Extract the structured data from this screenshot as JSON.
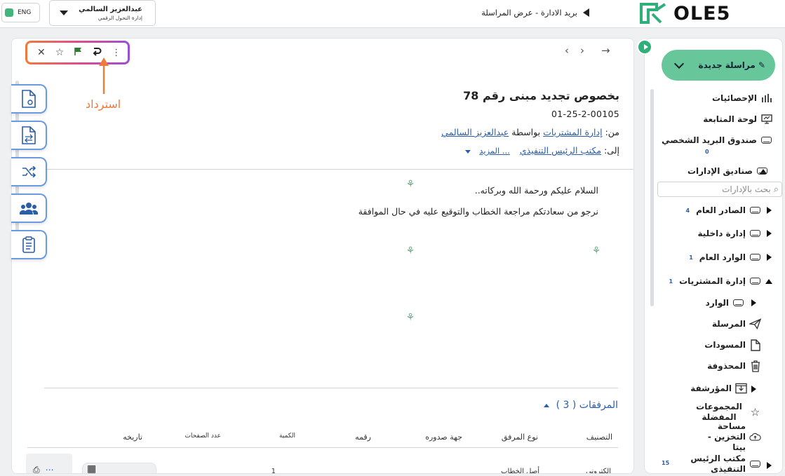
{
  "topbar": {
    "lang_label": "ENG",
    "user_name": "عبدالعزيز السالمي",
    "user_dept": "إدارة التحول الرقمي",
    "breadcrumb": "بريد الادارة - عرض المراسلة",
    "logo_text": "OLE5"
  },
  "sidebar": {
    "new_message": "مراسلة جديدة",
    "dept_search_placeholder": "بحث بالإدارات",
    "items": [
      {
        "label": "الإحصائيات",
        "icon": "bar-chart-icon"
      },
      {
        "label": "لوحة المتابعة",
        "icon": "dashboard-icon"
      },
      {
        "label": "صندوق البريد الشخصي",
        "icon": "inbox-icon",
        "count": "0"
      },
      {
        "label": "صناديق الإدارات",
        "icon": "inbox-icon"
      },
      {
        "label": "الصادر العام",
        "icon": "inbox-icon",
        "count": "4"
      },
      {
        "label": "إدارة داخلية",
        "icon": "inbox-icon"
      },
      {
        "label": "الوارد العام",
        "icon": "inbox-icon",
        "count": "1"
      },
      {
        "label": "إدارة المشتريات",
        "icon": "inbox-icon",
        "count": "1"
      },
      {
        "label": "الوارد",
        "icon": "inbox-icon"
      },
      {
        "label": "المرسلة",
        "icon": "send-icon"
      },
      {
        "label": "المسودات",
        "icon": "draft-icon"
      },
      {
        "label": "المحذوفة",
        "icon": "trash-icon"
      },
      {
        "label": "المؤرشفة",
        "icon": "archive-icon"
      },
      {
        "label": "المجموعات المفضلة",
        "icon": "star-icon"
      },
      {
        "label": "مساحة التخزين - بيتا",
        "icon": "cloud-icon"
      },
      {
        "label": "مكتب الرئيس التنفيذي",
        "icon": "inbox-icon",
        "count": "15"
      }
    ]
  },
  "message": {
    "subject": "بخصوص تجديد مبنى رقم 78",
    "ref_no": "01-25-2-00105",
    "from_label": "من:",
    "from_dept": "إدارة المشتريات",
    "by_label": "بواسطة",
    "from_user": "عبدالعزيز السالمي",
    "to_label": "إلى:",
    "to_dept": "مكتب الرئيس التنفيذي",
    "more_label": "... المزيد",
    "greeting": "السلام عليكم ورحمة الله وبركاته..",
    "body": "نرجو من سعادتكم مراجعة الخطاب والتوقيع عليه في حال الموافقة"
  },
  "attachments": {
    "title": "المرفقات ( 3 )",
    "headers": [
      "التصنيف",
      "نوع المرفق",
      "جهة صدوره",
      "رقمه",
      "الكمية",
      "عدد الصفحات",
      "تاريخه"
    ],
    "first_row": {
      "category": "الكتروني",
      "type": "أصل الخطاب",
      "quantity": "1"
    }
  },
  "annotation": {
    "label": "استرداد",
    "color": "#ef7a3a"
  },
  "colors": {
    "accent": "#2fb07a",
    "link": "#2a5ea8",
    "new_message_bg": "#68c79a"
  }
}
